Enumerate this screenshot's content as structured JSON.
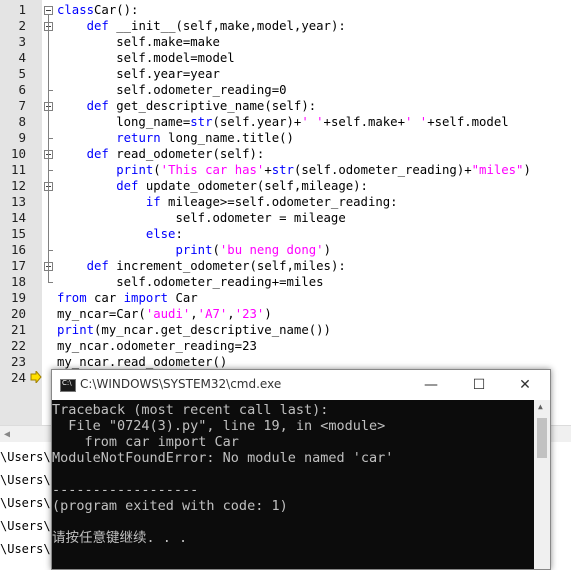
{
  "editor": {
    "line_numbers": [
      "1",
      "2",
      "3",
      "4",
      "5",
      "6",
      "7",
      "8",
      "9",
      "10",
      "11",
      "12",
      "13",
      "14",
      "15",
      "16",
      "17",
      "18",
      "19",
      "20",
      "21",
      "22",
      "23",
      "24"
    ],
    "lines": [
      [
        [
          "kw",
          "class"
        ],
        [
          "",
          "Car"
        ],
        [
          "",
          "():"
        ]
      ],
      [
        [
          "",
          "    "
        ],
        [
          "kw",
          "def"
        ],
        [
          "",
          " __init__(self,make,model,year):"
        ]
      ],
      [
        [
          "",
          "        self.make=make"
        ]
      ],
      [
        [
          "",
          "        self.model=model"
        ]
      ],
      [
        [
          "",
          "        self.year=year"
        ]
      ],
      [
        [
          "",
          "        self.odometer_reading=0"
        ]
      ],
      [
        [
          "",
          "    "
        ],
        [
          "kw",
          "def"
        ],
        [
          "",
          " get_descriptive_name(self):"
        ]
      ],
      [
        [
          "",
          "        long_name="
        ],
        [
          "kw",
          "str"
        ],
        [
          "",
          "(self.year)+"
        ],
        [
          "st",
          "' '"
        ],
        [
          "",
          "+self.make+"
        ],
        [
          "st",
          "' '"
        ],
        [
          "",
          "+self.model"
        ]
      ],
      [
        [
          "",
          "        "
        ],
        [
          "kw",
          "return"
        ],
        [
          "",
          " long_name.title()"
        ]
      ],
      [
        [
          "",
          "    "
        ],
        [
          "kw",
          "def"
        ],
        [
          "",
          " read_odometer(self):"
        ]
      ],
      [
        [
          "",
          "        "
        ],
        [
          "kw",
          "print"
        ],
        [
          "",
          "("
        ],
        [
          "st",
          "'This car has'"
        ],
        [
          "",
          "+"
        ],
        [
          "kw",
          "str"
        ],
        [
          "",
          "(self.odometer_reading)+"
        ],
        [
          "st",
          "\"miles\""
        ],
        [
          "",
          ")"
        ]
      ],
      [
        [
          "",
          "        "
        ],
        [
          "kw",
          "def"
        ],
        [
          "",
          " update_odometer(self,mileage):"
        ]
      ],
      [
        [
          "",
          "            "
        ],
        [
          "kw",
          "if"
        ],
        [
          "",
          " mileage>=self.odometer_reading:"
        ]
      ],
      [
        [
          "",
          "                self.odometer = mileage"
        ]
      ],
      [
        [
          "",
          "            "
        ],
        [
          "kw",
          "else"
        ],
        [
          "",
          ":"
        ]
      ],
      [
        [
          "",
          "                "
        ],
        [
          "kw",
          "print"
        ],
        [
          "",
          "("
        ],
        [
          "st",
          "'bu neng dong'"
        ],
        [
          "",
          ")"
        ]
      ],
      [
        [
          "",
          "    "
        ],
        [
          "kw",
          "def"
        ],
        [
          "",
          " increment_odometer(self,miles):"
        ]
      ],
      [
        [
          "",
          "        self.odometer_reading+=miles"
        ]
      ],
      [
        [
          "kw",
          "from"
        ],
        [
          "",
          " car "
        ],
        [
          "kw",
          "import"
        ],
        [
          "",
          " Car"
        ]
      ],
      [
        [
          "",
          "my_ncar=Car("
        ],
        [
          "st",
          "'audi'"
        ],
        [
          "",
          ","
        ],
        [
          "st",
          "'A7'"
        ],
        [
          "",
          ","
        ],
        [
          "st",
          "'23'"
        ],
        [
          "",
          ")"
        ]
      ],
      [
        [
          "kw",
          "print"
        ],
        [
          "",
          "(my_ncar.get_descriptive_name())"
        ]
      ],
      [
        [
          "",
          "my_ncar.odometer_reading=23"
        ]
      ],
      [
        [
          "",
          "my_ncar.read_odometer()"
        ]
      ],
      [
        [
          "",
          ""
        ]
      ]
    ]
  },
  "background_lines": [
    "\\Users\\d",
    "\\Users\\d",
    "\\Users\\d",
    "\\Users\\d",
    "\\Users\\d"
  ],
  "cmd": {
    "title": "C:\\WINDOWS\\SYSTEM32\\cmd.exe",
    "minimize": "—",
    "maximize": "☐",
    "close": "✕",
    "output": [
      "Traceback (most recent call last):",
      "  File \"0724(3).py\", line 19, in <module>",
      "    from car import Car",
      "ModuleNotFoundError: No module named 'car'",
      "",
      "------------------",
      "(program exited with code: 1)",
      "",
      "请按任意键继续. . ."
    ]
  },
  "colors": {
    "keyword": "#0000ff",
    "string": "#ff00ff",
    "console_bg": "#0c0c0c",
    "console_fg": "#c0c0c0"
  },
  "icons": {
    "current_line_marker": "arrow-right-icon",
    "cmd_icon": "cmd-icon"
  }
}
